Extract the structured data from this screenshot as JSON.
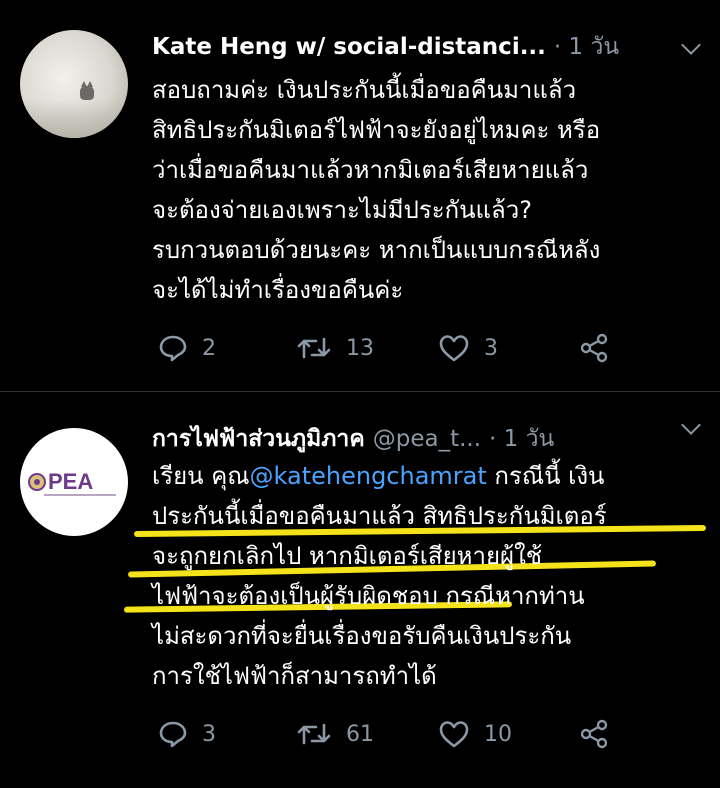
{
  "tweets": [
    {
      "name": "Kate Heng w/ social-distanci...",
      "handle": "",
      "time": "· 1 วัน",
      "lines": [
        "สอบถามค่ะ เงินประกันนี้เมื่อขอคืนมาแล้ว",
        "สิทธิประกันมิเตอร์ไฟฟ้าจะยังอยู่ไหมคะ หรือ",
        "ว่าเมื่อขอคืนมาแล้วหากมิเตอร์เสียหายแล้ว",
        "จะต้องจ่ายเองเพราะไม่มีประกันแล้ว?",
        "รบกวนตอบด้วยนะคะ หากเป็นแบบกรณีหลัง",
        "จะได้ไม่ทำเรื่องขอคืนค่ะ"
      ],
      "replies": "2",
      "retweets": "13",
      "likes": "3"
    },
    {
      "name": "การไฟฟ้าส่วนภูมิภาค",
      "handle": "@pea_t...",
      "time": "· 1 วัน",
      "avatar_text": "PEA",
      "line1_prefix": "เรียน คุณ",
      "mention": "@katehengchamrat",
      "line1_suffix": " กรณีนี้ เงิน",
      "lines": [
        "ประกันนี้เมื่อขอคืนมาแล้ว สิทธิประกันมิเตอร์",
        "จะถูกยกเลิกไป หากมิเตอร์เสียหายผู้ใช้",
        "ไฟฟ้าจะต้องเป็นผู้รับผิดชอบ กรณีหากท่าน",
        "ไม่สะดวกที่จะยื่นเรื่องขอรับคืนเงินประกัน",
        "การใช้ไฟฟ้าก็สามารถทำได้"
      ],
      "replies": "3",
      "retweets": "61",
      "likes": "10"
    }
  ],
  "colors": {
    "background": "#000000",
    "secondary_text": "#8b98a5",
    "mention": "#4aa3ff",
    "highlight": "#f4e31a",
    "pea_purple": "#6e3a8c"
  },
  "icons": [
    "reply-icon",
    "retweet-icon",
    "like-icon",
    "share-icon",
    "chevron-down-icon"
  ]
}
